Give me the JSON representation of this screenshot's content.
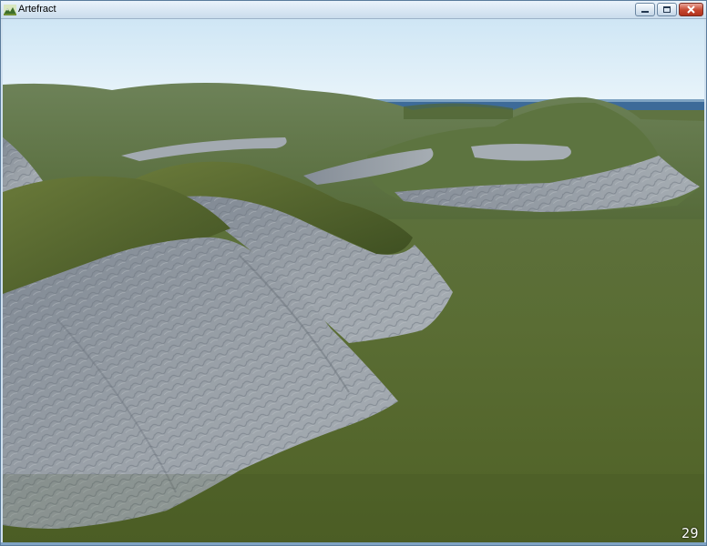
{
  "window": {
    "title": "Artefract",
    "icon": "terrain-app-icon",
    "controls": {
      "minimize": "minimize-icon",
      "maximize": "maximize-icon",
      "close": "close-icon"
    }
  },
  "viewport": {
    "scene": "3d-terrain-render",
    "fps_counter": "29"
  },
  "colors": {
    "sky_top": "#d6ebf7",
    "sky_horizon": "#eaf5fa",
    "sea": "#3e6e9e",
    "grass": "#5a6e36",
    "rock": "#8c949c"
  }
}
